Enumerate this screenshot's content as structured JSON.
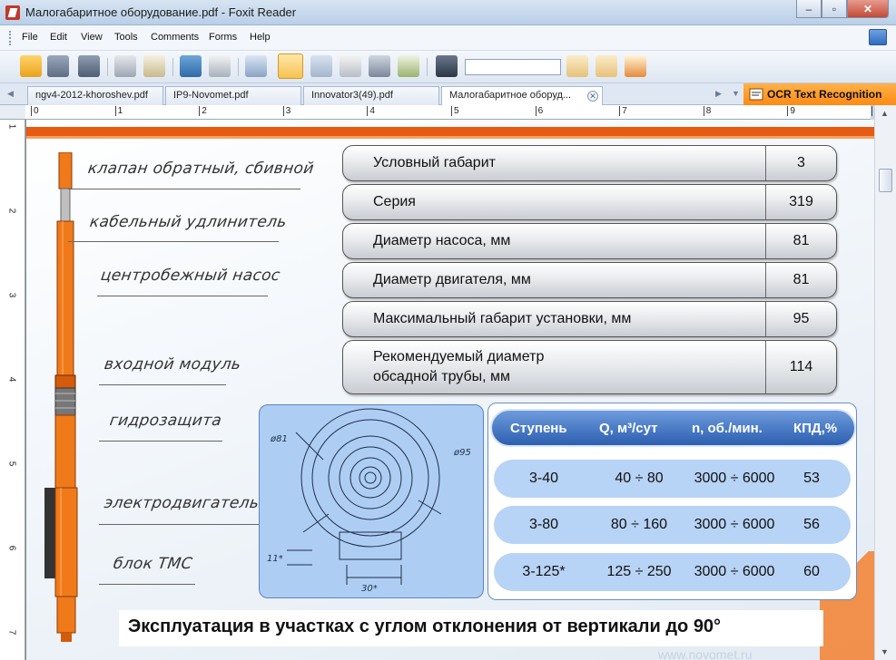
{
  "window": {
    "title": "Малогабаритное оборудование.pdf - Foxit Reader",
    "min": "–",
    "max": "▫",
    "close": "✕"
  },
  "menu": [
    "File",
    "Edit",
    "View",
    "Tools",
    "Comments",
    "Forms",
    "Help"
  ],
  "toolbar": {
    "buttons": [
      "open-icon",
      "save-icon",
      "save-as-icon",
      "print-icon",
      "email-icon",
      "fullscreen-icon",
      "find-text-icon",
      "snapshot-select-icon",
      "hand-tool-icon",
      "select-arrow-icon",
      "text-select-icon",
      "camera-icon",
      "typewriter-icon",
      "binoculars-icon",
      "prev-result-icon",
      "next-result-icon",
      "highlight-icon"
    ],
    "search_value": ""
  },
  "tabs": [
    {
      "label": "ngv4-2012-khoroshev.pdf",
      "active": false
    },
    {
      "label": "IP9-Novomet.pdf",
      "active": false
    },
    {
      "label": "Innovator3(49).pdf",
      "active": false
    },
    {
      "label": "Малогабаритное оборуд...",
      "active": true
    }
  ],
  "ocr_label": "OCR Text Recognition",
  "ruler": {
    "h": [
      "0",
      "1",
      "2",
      "3",
      "4",
      "5",
      "6",
      "7",
      "8",
      "9",
      "1"
    ],
    "v": [
      "1",
      "2",
      "3",
      "4",
      "5",
      "6",
      "7"
    ]
  },
  "doc": {
    "labels": [
      "клапан обратный, сбивной",
      "кабельный удлинитель",
      "центробежный насос",
      "входной модуль",
      "гидрозащита",
      "электродвигатель",
      "блок ТМС"
    ],
    "specs": [
      {
        "k": "Условный габарит",
        "v": "3"
      },
      {
        "k": "Серия",
        "v": "319"
      },
      {
        "k": "Диаметр насоса, мм",
        "v": "81"
      },
      {
        "k": "Диаметр двигателя, мм",
        "v": "81"
      },
      {
        "k": "Максимальный габарит установки, мм",
        "v": "95"
      },
      {
        "k": "Рекомендуемый  диаметр\nобсадной трубы,  мм",
        "v": "114"
      }
    ],
    "drawing": {
      "d1": "ø81",
      "d2": "ø95",
      "h": "11*",
      "w": "30*"
    },
    "perf": {
      "headers": [
        "Ступень",
        "Q, м³/сут",
        "n, об./мин.",
        "КПД,%"
      ],
      "rows": [
        [
          "3-40",
          "40 ÷ 80",
          "3000 ÷ 6000",
          "53"
        ],
        [
          "3-80",
          "80 ÷ 160",
          "3000 ÷ 6000",
          "56"
        ],
        [
          "3-125*",
          "125 ÷ 250",
          "3000 ÷ 6000",
          "60"
        ]
      ]
    },
    "footer": "Эксплуатация в участках с углом отклонения от вертикали до 90°",
    "url": "www.novomet.ru"
  },
  "colors": {
    "accent": "#e75a12",
    "pump_orange": "#f07a1a",
    "table_blue": "#2c5fb0",
    "row_blue": "#b7d3f5"
  }
}
